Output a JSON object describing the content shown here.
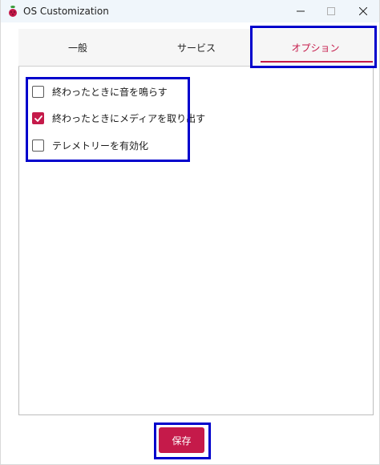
{
  "window": {
    "title": "OS Customization"
  },
  "tabs": [
    {
      "label": "一般"
    },
    {
      "label": "サービス"
    },
    {
      "label": "オプション"
    }
  ],
  "active_tab": "オプション",
  "options": [
    {
      "label": "終わったときに音を鳴らす",
      "checked": false
    },
    {
      "label": "終わったときにメディアを取り出す",
      "checked": true
    },
    {
      "label": "テレメトリーを有効化",
      "checked": false
    }
  ],
  "save_button": {
    "label": "保存"
  },
  "colors": {
    "accent": "#c51a4a",
    "highlight": "#0000cc",
    "titlebar": "#f0f6fb"
  },
  "icons": {
    "app": "raspberry-icon",
    "minimize": "minimize-icon",
    "maximize": "maximize-icon",
    "close": "close-icon"
  }
}
